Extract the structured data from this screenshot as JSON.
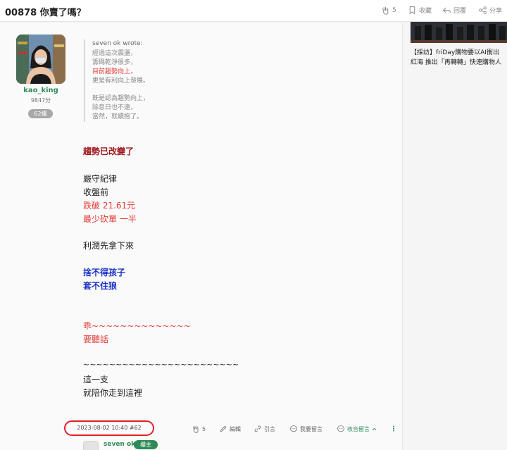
{
  "header": {
    "title": "00878 你賣了嗎？",
    "like_count": "5",
    "favorite_label": "收藏",
    "reply_label": "回覆",
    "share_label": "分享"
  },
  "author": {
    "name": "kao_king",
    "score": "9847分",
    "floor": "62樓"
  },
  "quote": {
    "header": "seven ok wrote:",
    "lines": [
      "經過這次震盪，",
      "籌碼乾淨很多，",
      "目前趨勢向上，",
      "更是有利向上發展。",
      "既是認為趨勢向上，",
      "除息日也不遠，",
      "當然，就續抱了。"
    ]
  },
  "post": {
    "lines": [
      "趨勢已改變了",
      "嚴守紀律",
      "收盤前",
      "跌破 21.61元",
      "最少砍單 一半",
      "利潤先拿下來",
      "捨不得孩子",
      "套不住狼",
      "乖~~~~~~~~~~~~~~",
      "要聽話",
      "~~~~~~~~~~~~~~~~~~~~~~~~",
      "這一支",
      "就陪你走到這裡"
    ]
  },
  "footer": {
    "datetime": "2023-08-02 10:40 #62",
    "like_count": "5",
    "edit_label": "編輯",
    "quote_label": "引言",
    "comment_label": "我要留言",
    "collapse_label": "收合留言",
    "more_icon": "⋮"
  },
  "reply": {
    "name": "seven ok",
    "badge": "樓主"
  },
  "sidebar": {
    "article_line1": "【採訪】friDay購物要以AI衝出",
    "article_line2": "紅海 推出「再轉轉」快速購物人"
  },
  "colors": {
    "green": "#2e8b57",
    "red": "#e53935",
    "blue": "#1a32c8",
    "highlight_border": "#e0202a"
  }
}
